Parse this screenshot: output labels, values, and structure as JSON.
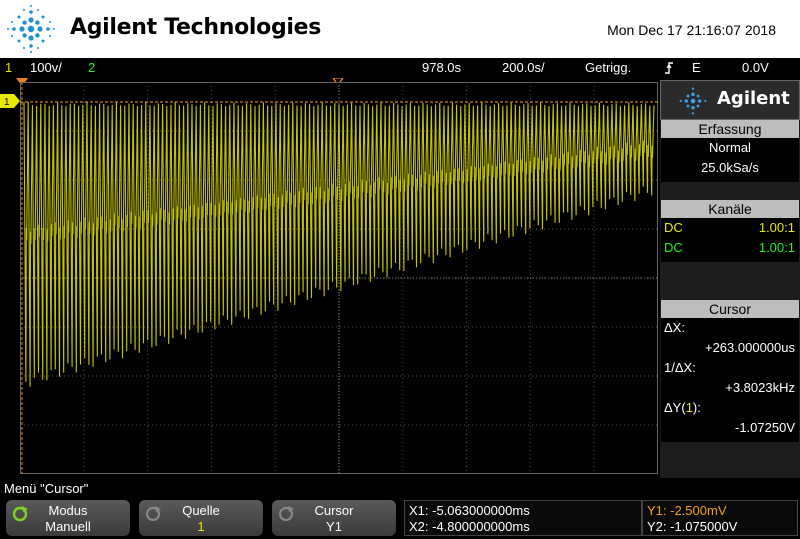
{
  "header": {
    "brand": "Agilent Technologies",
    "datetime": "Mon Dec 17 21:16:07 2018"
  },
  "status_bar": {
    "ch1_label": "1",
    "ch1_scale": "100v/",
    "ch2_label": "2",
    "time_offset": "978.0s",
    "time_scale": "200.0s/",
    "trigger_mode": "Getrigg.",
    "trigger_icon": "trigger-edge-icon",
    "trigger_source": "E",
    "trigger_level": "0.0V"
  },
  "side_panel": {
    "logo_text": "Agilent",
    "acquisition": {
      "title": "Erfassung",
      "mode": "Normal",
      "rate": "25.0kSa/s"
    },
    "channels": {
      "title": "Kanäle",
      "rows": [
        {
          "coupling": "DC",
          "ratio": "1.00:1",
          "color": "#e8e800"
        },
        {
          "coupling": "DC",
          "ratio": "1.00:1",
          "color": "#22ee22"
        }
      ]
    },
    "cursor": {
      "title": "Cursor",
      "dx_label": "ΔX:",
      "dx_value": "+263.000000us",
      "inv_dx_label": "1/ΔX:",
      "inv_dx_value": "+3.8023kHz",
      "dy_label_prefix": "ΔY(",
      "dy_label_ch": "1",
      "dy_label_suffix": "):",
      "dy_value": "-1.07250V"
    }
  },
  "menu_title": "Menü \"Cursor\"",
  "softkeys": [
    {
      "title": "Modus",
      "value": "Manuell"
    },
    {
      "title": "Quelle",
      "value": "1"
    },
    {
      "title": "Cursor",
      "value": "Y1"
    }
  ],
  "readouts": {
    "x1": "X1: -5.063000000ms",
    "x2": "X2: -4.800000000ms",
    "y1": "Y1: -2.500mV",
    "y2": "Y2: -1.075000V"
  },
  "colors": {
    "ch1": "#e8e800",
    "ch2": "#22ee22",
    "y1": "#f0a020"
  }
}
